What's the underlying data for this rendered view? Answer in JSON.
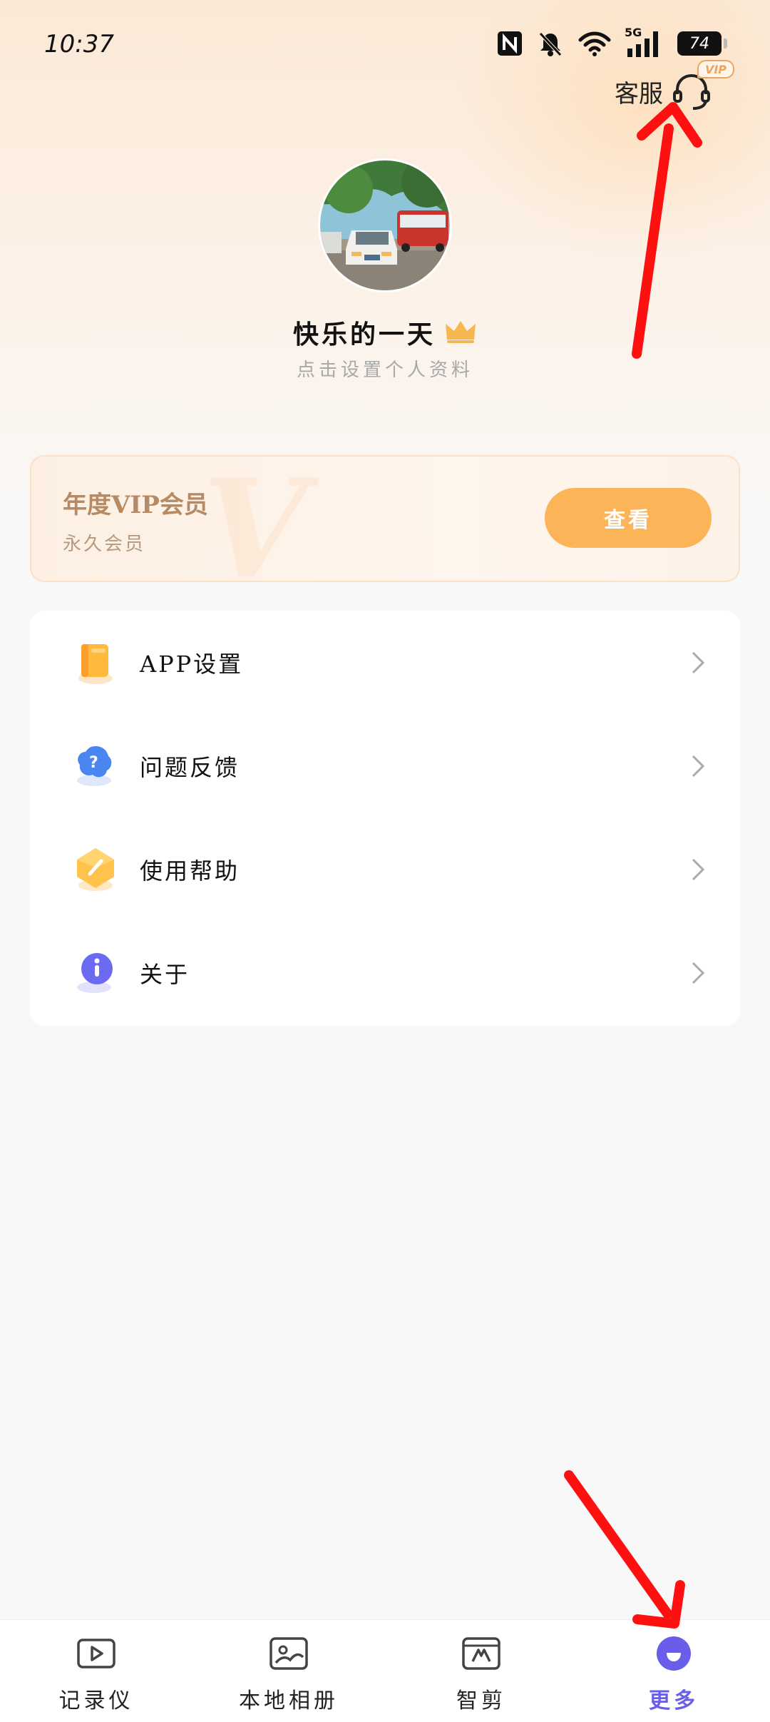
{
  "status_bar": {
    "time": "10:37",
    "network": "5G",
    "battery": "74",
    "icons": [
      "nfc-icon",
      "bell-muted-icon",
      "wifi-icon",
      "signal-icon",
      "battery-icon"
    ]
  },
  "header": {
    "service_label": "客服",
    "service_badge": "VIP"
  },
  "profile": {
    "nickname": "快乐的一天",
    "subtitle": "点击设置个人资料"
  },
  "vip_card": {
    "title": "年度VIP会员",
    "subtitle": "永久会员",
    "watermark": "V",
    "button_label": "查看"
  },
  "menu": {
    "items": [
      {
        "label": "APP设置",
        "icon": "settings-book-icon"
      },
      {
        "label": "问题反馈",
        "icon": "feedback-icon"
      },
      {
        "label": "使用帮助",
        "icon": "help-icon"
      },
      {
        "label": "关于",
        "icon": "info-icon"
      }
    ]
  },
  "tabbar": {
    "tabs": [
      {
        "label": "记录仪",
        "icon": "video-recorder-icon",
        "active": false
      },
      {
        "label": "本地相册",
        "icon": "album-icon",
        "active": false
      },
      {
        "label": "智剪",
        "icon": "smart-edit-icon",
        "active": false
      },
      {
        "label": "更多",
        "icon": "more-icon",
        "active": true
      }
    ]
  },
  "colors": {
    "accent": "#6a5ee8",
    "vip_button": "#fbb457",
    "vip_text": "#b58a64",
    "annotation": "#ff1010"
  }
}
